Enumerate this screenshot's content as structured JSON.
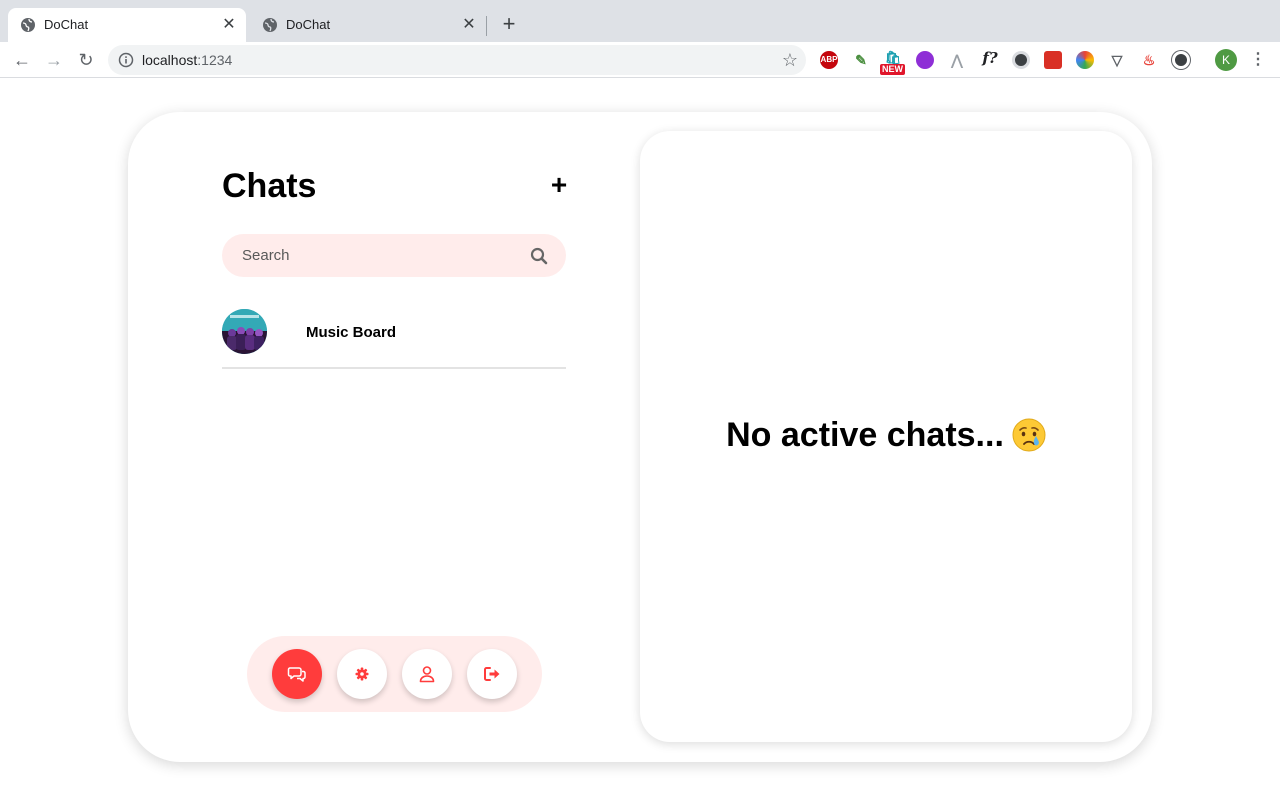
{
  "browser": {
    "tabs": [
      {
        "title": "DoChat",
        "active": true
      },
      {
        "title": "DoChat",
        "active": false
      }
    ],
    "url_host": "localhost",
    "url_port": ":1234",
    "extensions": [
      "ABP",
      "eyedropper",
      "shopping-bag",
      "purple-circle",
      "triangle",
      "f?",
      "dark-reader",
      "red-square",
      "color-wheel",
      "vue",
      "fire",
      "pill"
    ],
    "extension_badge": "NEW",
    "profile_initial": "K"
  },
  "sidebar": {
    "title": "Chats",
    "add_label": "+",
    "search": {
      "placeholder": "Search",
      "value": ""
    },
    "chats": [
      {
        "name": "Music Board",
        "avatar": "band-photo-avatar"
      }
    ]
  },
  "bottom_nav": [
    {
      "name": "chats",
      "icon": "chat-bubbles-icon",
      "active": true
    },
    {
      "name": "settings",
      "icon": "gear-icon",
      "active": false
    },
    {
      "name": "profile",
      "icon": "user-icon",
      "active": false
    },
    {
      "name": "logout",
      "icon": "logout-icon",
      "active": false
    }
  ],
  "main": {
    "empty_message": "No active chats..."
  },
  "colors": {
    "accent": "#ff3c3c",
    "accent_soft": "#ffeceb"
  }
}
